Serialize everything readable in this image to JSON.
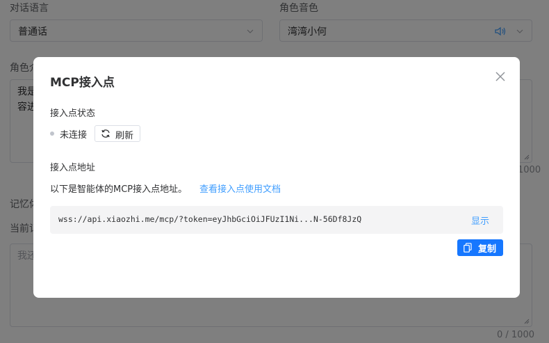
{
  "form": {
    "language": {
      "label": "对话语言",
      "value": "普通话"
    },
    "voice": {
      "label": "角色音色",
      "value": "湾湾小何"
    },
    "intro": {
      "label": "角色介绍",
      "text_line1": "我是",
      "text_line2": "容进",
      "count": "1000"
    },
    "memory": {
      "label": "记忆体",
      "current_label": "当前记忆",
      "placeholder": "我还",
      "count": "0 / 1000"
    }
  },
  "dialog": {
    "title": "MCP接入点",
    "status_section": "接入点状态",
    "status": "未连接",
    "refresh_label": "刷新",
    "address_section": "接入点地址",
    "description": "以下是智能体的MCP接入点地址。",
    "doc_link": "查看接入点使用文档",
    "address": "wss://api.xiaozhi.me/mcp/?token=eyJhbGciOiJFUzI1Ni...N-56Df8JzQ",
    "show_label": "显示",
    "copy_label": "复制"
  },
  "colors": {
    "accent": "#409eff",
    "primary_button": "#1677ff",
    "overlay": "rgba(0,0,0,0.5)"
  }
}
